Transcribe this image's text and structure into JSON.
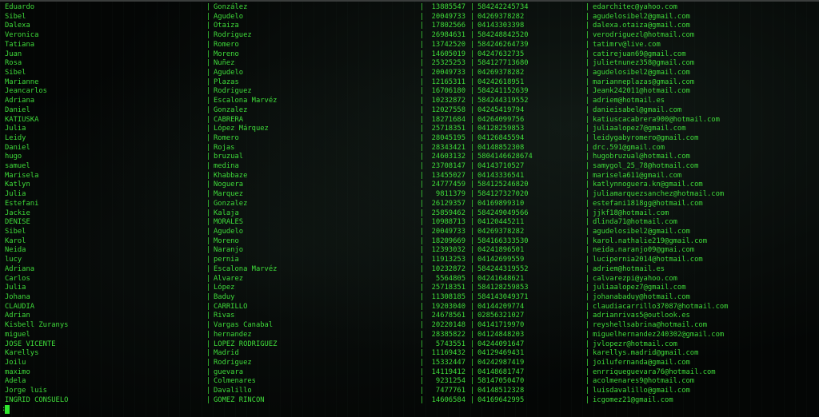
{
  "terminal": {
    "separator": "|",
    "prompt": ":",
    "text_color": "#3fdc3a",
    "background_color": "#040605",
    "rows": [
      [
        "Eduardo",
        "González",
        "13885547",
        "584242245734",
        "edarchitec@yahoo.com"
      ],
      [
        "Sibel",
        "Agudelo",
        "20049733",
        "04269378282",
        "agudelosibel2@gmail.com"
      ],
      [
        "Dalexa",
        "Otaiza",
        "17802566",
        "04143303398",
        "dalexa.otaiza@gmail.com"
      ],
      [
        "Veronica",
        "Rodriguez",
        "26984631",
        "584248842520",
        "verodriguezl@hotmail.com"
      ],
      [
        "Tatiana",
        "Romero",
        "13742520",
        "584246264739",
        "tatimrv@live.com"
      ],
      [
        "Juan",
        "Moreno",
        "14605019",
        "04247632735",
        "catirejuan69@gmail.com"
      ],
      [
        "Rosa",
        "Nuñez",
        "25325253",
        "584127713680",
        "julietnunez358@gmail.com"
      ],
      [
        "Sibel",
        "Agudelo",
        "20049733",
        "04269378282",
        "agudelosibel2@gmail.com"
      ],
      [
        "Marianne",
        "Plazas",
        "12165311",
        "04242618951",
        "marianneplazas@gmail.com"
      ],
      [
        "Jeancarlos",
        "Rodriguez",
        "16706180",
        "584241152639",
        "Jeank242011@hotmail.com"
      ],
      [
        "Adriana",
        "Escalona Marvéz",
        "10232872",
        "584244319552",
        "adriem@hotmail.es"
      ],
      [
        "Daniel",
        "Gonzalez",
        "12027558",
        "04245419794",
        "danieisabel@gmail.com"
      ],
      [
        "KATIUSKA",
        "CABRERA",
        "18271684",
        "04264099756",
        "katiuscacabrera900@hotmail.com"
      ],
      [
        "Julia",
        "López Márquez",
        "25718351",
        "04128259853",
        "juliaalopez7@gmail.com"
      ],
      [
        "Leidy",
        "Romero",
        "28045195",
        "04126845594",
        "leidygabyromero@gmail.com"
      ],
      [
        "Daniel",
        "Rojas",
        "28343421",
        "04148852308",
        "drc.591@gmail.com"
      ],
      [
        "hugo",
        "bruzual",
        "24603132",
        "5804146628674",
        "hugobruzual@hotmail.com"
      ],
      [
        "samuel",
        "medina",
        "23708147",
        "04143710527",
        "samygol_25_78@hotmail.com"
      ],
      [
        "Marisela",
        "Khabbaze",
        "13455027",
        "04143336541",
        "marisela611@gmail.com"
      ],
      [
        "Katlyn",
        "Noguera",
        "24777459",
        "584125246820",
        "katlynnoguera.kn@gmail.com"
      ],
      [
        "Julia",
        "Marquez",
        "9811379",
        "584127327020",
        "juliamarquezsanchez@hotmail.com"
      ],
      [
        "Estefani",
        "Gonzalez",
        "26129357",
        "04169899310",
        "estefani1818gg@hotmail.com"
      ],
      [
        "Jackie",
        "Kalaja",
        "25859462",
        "584249049566",
        "jjkf18@hotmail.com"
      ],
      [
        "DENISE",
        "MORALES",
        "10988713",
        "04120445211",
        "dlinda71@hotmail.com"
      ],
      [
        "Sibel",
        "Agudelo",
        "20049733",
        "04269378282",
        "agudelosibel2@gmail.com"
      ],
      [
        "Karol",
        "Moreno",
        "18209669",
        "584166333530",
        "karol.nathalie219@gmail.com"
      ],
      [
        "Neida",
        "Naranjo",
        "12393032",
        "04241896501",
        "neida.naranjo09@gmai.com"
      ],
      [
        "lucy",
        "pernia",
        "11913253",
        "04142699559",
        "lucipernia2014@hotmail.com"
      ],
      [
        "Adriana",
        "Escalona Marvéz",
        "10232872",
        "584244319552",
        "adriem@hotmail.es"
      ],
      [
        "Carlos",
        "Alvarez",
        "5564805",
        "04241648621",
        "calvarezpi@yahoo.com"
      ],
      [
        "Julia",
        "López",
        "25718351",
        "584128259853",
        "juliaalopez7@gmail.com"
      ],
      [
        "Johana",
        "Baduy",
        "11308185",
        "584143049371",
        "johanabaduy@hotmail.com"
      ],
      [
        "CLAUDIA",
        "CARRILLO",
        "19203040",
        "04144209774",
        "claudiacarrillo37087@hotmail.com"
      ],
      [
        "Adrian",
        "Rivas",
        "24678561",
        "02856321027",
        "adrianrivas5@outlook.es"
      ],
      [
        "Kisbell Zuranys",
        "Vargas Canabal",
        "20220148",
        "04141719970",
        "reyshellsabrina@hotmail.com"
      ],
      [
        "miguel",
        "hernandez",
        "28385822",
        "04124848203",
        "miguelhernandez240302@gmail.com"
      ],
      [
        "JOSE VICENTE",
        "LOPEZ RODRIGUEZ",
        "5743551",
        "04244091647",
        "jvlopezr@hotmail.com"
      ],
      [
        "Karellys",
        "Madrid",
        "11169432",
        "04129469431",
        "karellys.madrid@gmail.com"
      ],
      [
        "Joilu",
        "Rodriguez",
        "15332447",
        "04242987419",
        "joilufernanda@gmail.com"
      ],
      [
        "maximo",
        "guevara",
        "14119412",
        "04148681747",
        "enrriqueguevara76@hotmail.com"
      ],
      [
        "Adela",
        "Colmenares",
        "9231254",
        "58147050470",
        "acolmenares9@hotmail.com"
      ],
      [
        "Jorge luis",
        "Davalillo",
        "7477761",
        "04148512328",
        "luisdavalillo@gmail.com"
      ],
      [
        "INGRID CONSUELO",
        "GOMEZ RINCON",
        "14606584",
        "04169642995",
        "icgomez21@gmail.com"
      ]
    ]
  }
}
